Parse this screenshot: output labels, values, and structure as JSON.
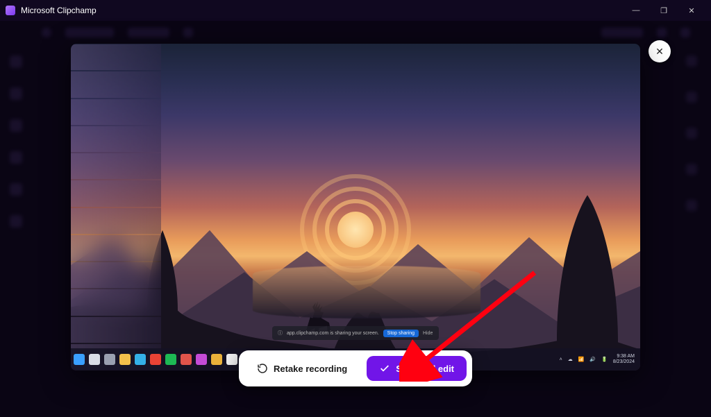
{
  "app": {
    "title": "Microsoft Clipchamp"
  },
  "window_controls": {
    "minimize": "—",
    "maximize": "❐",
    "close": "✕"
  },
  "modal": {
    "close_label": "✕",
    "buttons": {
      "retake": "Retake recording",
      "save_edit": "Save and edit"
    },
    "share_notice": {
      "text": "app.clipchamp.com is sharing your screen.",
      "stop": "Stop sharing",
      "hide": "Hide"
    },
    "taskbar": {
      "icons": [
        {
          "name": "start",
          "color": "#3aa0ff"
        },
        {
          "name": "search",
          "color": "#d9dde6"
        },
        {
          "name": "task-view",
          "color": "#9aa0b0"
        },
        {
          "name": "explorer",
          "color": "#f3c04b"
        },
        {
          "name": "edge",
          "color": "#34b1e8"
        },
        {
          "name": "chrome",
          "color": "#ea4335"
        },
        {
          "name": "spotify",
          "color": "#1db954"
        },
        {
          "name": "app1",
          "color": "#e0544b"
        },
        {
          "name": "app2",
          "color": "#c44bd6"
        },
        {
          "name": "app3",
          "color": "#eab13a"
        },
        {
          "name": "app4",
          "color": "#f0f0f0"
        },
        {
          "name": "app5",
          "color": "#ff6a3d"
        },
        {
          "name": "app6",
          "color": "#e63b7a"
        },
        {
          "name": "app7",
          "color": "#4356d6"
        },
        {
          "name": "app8",
          "color": "#45c1c9"
        },
        {
          "name": "app9",
          "color": "#7d3fe0"
        },
        {
          "name": "app10",
          "color": "#d0d4e0"
        },
        {
          "name": "clipchamp",
          "color": "#8b5cf6"
        }
      ],
      "time": "9:38 AM",
      "date": "8/23/2024"
    }
  },
  "colors": {
    "accent": "#7115e8"
  }
}
